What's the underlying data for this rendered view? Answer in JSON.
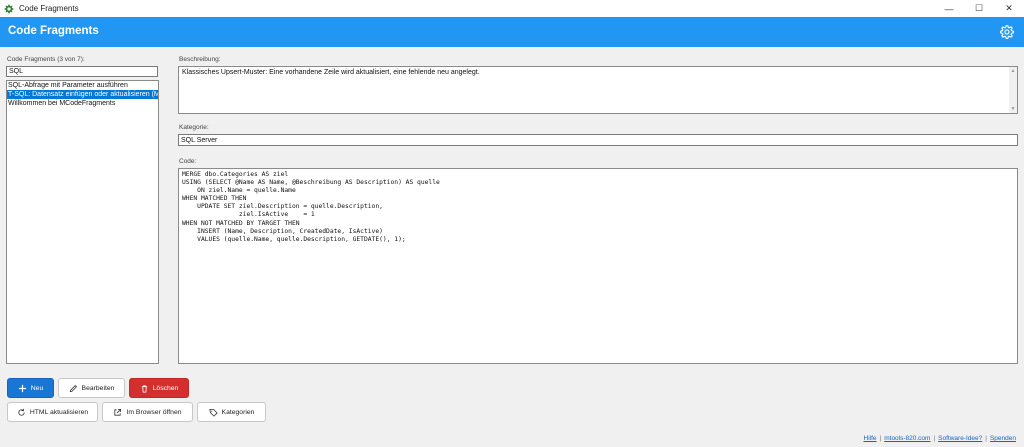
{
  "window": {
    "title": "Code Fragments",
    "controls": {
      "minimize": "—",
      "maximize": "☐",
      "close": "✕"
    }
  },
  "header": {
    "title": "Code Fragments",
    "settings_icon": "gear-icon"
  },
  "left": {
    "list_label": "Code Fragments (3 von 7):",
    "search_value": "SQL",
    "items": [
      {
        "label": "SQL-Abfrage mit Parameter ausführen",
        "selected": false
      },
      {
        "label": "T-SQL: Datensatz einfügen oder aktualisieren (MERGE)",
        "selected": true
      },
      {
        "label": "Willkommen bei MCodeFragments",
        "selected": false
      }
    ]
  },
  "right": {
    "description_label": "Beschreibung:",
    "description": "Klassisches Upsert-Muster: Eine vorhandene Zeile wird aktualisiert, eine fehlende neu angelegt.",
    "category_label": "Kategorie:",
    "category_value": "SQL Server",
    "code_label": "Code:",
    "code_lines": [
      "MERGE dbo.Categories AS ziel",
      "USING (SELECT @Name AS Name, @Beschreibung AS Description) AS quelle",
      "    ON ziel.Name = quelle.Name",
      "WHEN MATCHED THEN",
      "    UPDATE SET ziel.Description = quelle.Description,",
      "               ziel.IsActive    = 1",
      "WHEN NOT MATCHED BY TARGET THEN",
      "    INSERT (Name, Description, CreatedDate, IsActive)",
      "    VALUES (quelle.Name, quelle.Description, GETDATE(), 1);"
    ]
  },
  "buttons": {
    "new": "Neu",
    "edit": "Bearbeiten",
    "delete": "Löschen",
    "refresh_html": "HTML aktualisieren",
    "open_browser": "Im Browser öffnen",
    "categories": "Kategorien"
  },
  "footer": {
    "help": "Hilfe",
    "site": "mtools-820.com",
    "idea": "Software-Idee?",
    "donate": "Spenden",
    "sep": "|"
  },
  "colors": {
    "accent": "#2196f3",
    "primary_button": "#1976d2",
    "danger_button": "#d32f2f",
    "selection": "#0078d7"
  }
}
